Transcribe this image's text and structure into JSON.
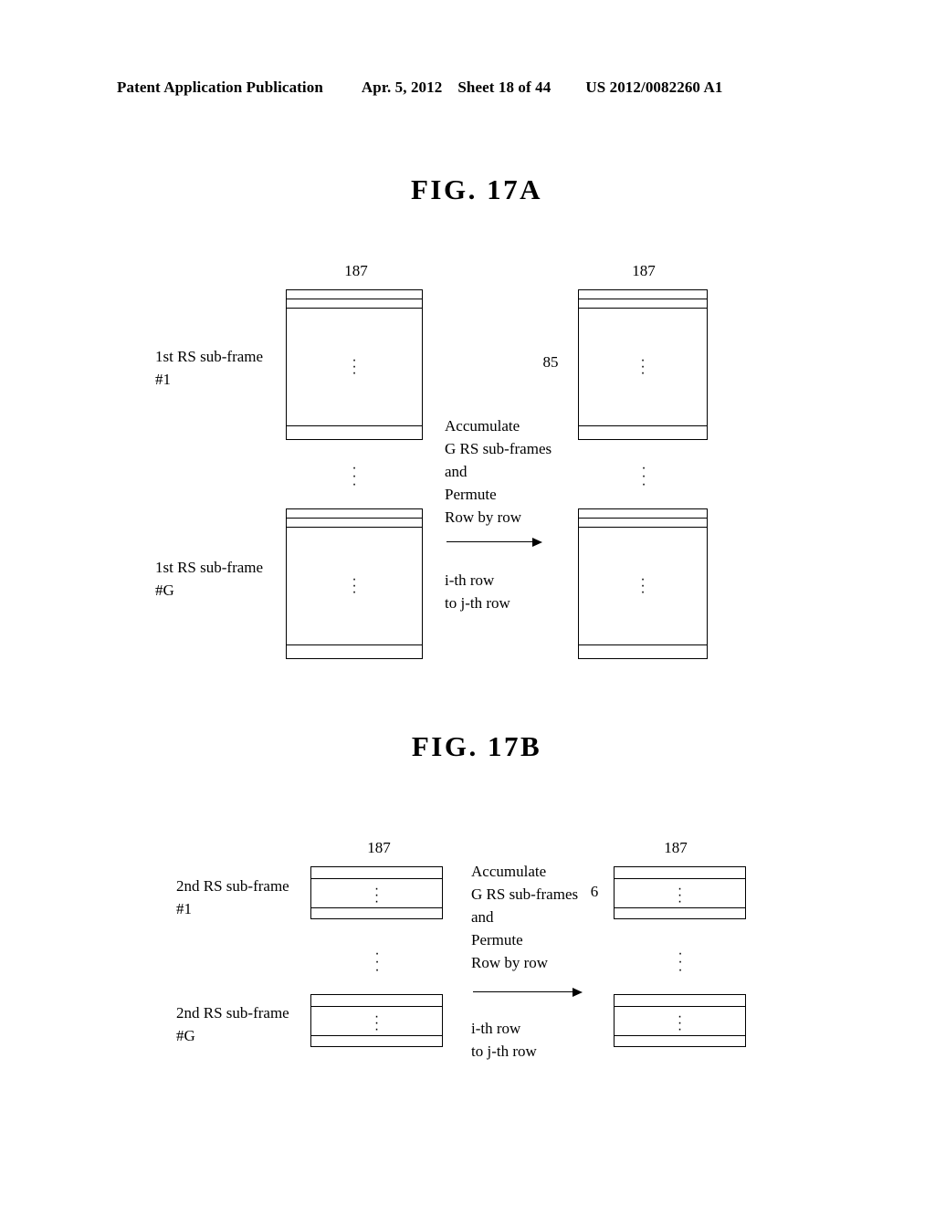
{
  "header": {
    "publication": "Patent Application Publication",
    "date": "Apr. 5, 2012",
    "sheet": "Sheet 18 of 44",
    "patent_number": "US 2012/0082260 A1"
  },
  "figures": [
    {
      "id": "fig17a",
      "title": "FIG. 17A",
      "left_blocks": [
        {
          "label_line1": "1st RS sub-frame",
          "label_line2": "#1",
          "top_width": "187",
          "dots": "⋮"
        },
        {
          "label_line1": "1st RS sub-frame",
          "label_line2": "#G",
          "top_width": "",
          "dots": "⋮"
        }
      ],
      "right_blocks": [
        {
          "top_width": "187",
          "side_label": "85",
          "dots": "⋮"
        },
        {
          "top_width": "",
          "side_label": "",
          "dots": "⋮"
        }
      ],
      "center": {
        "instruction": "Accumulate\nG RS sub-frames\nand\nPermute\nRow by row",
        "arrow": "arrow-right",
        "row_mapping": "i-th row\nto j-th row"
      },
      "column_ellipsis": "⋮"
    },
    {
      "id": "fig17b",
      "title": "FIG. 17B",
      "left_blocks": [
        {
          "label_line1": "2nd RS sub-frame",
          "label_line2": "#1",
          "top_width": "187",
          "dots": "⋮"
        },
        {
          "label_line1": "2nd RS sub-frame",
          "label_line2": "#G",
          "top_width": "",
          "dots": "⋮"
        }
      ],
      "right_blocks": [
        {
          "top_width": "187",
          "side_label": "6",
          "dots": "⋮"
        },
        {
          "top_width": "",
          "side_label": "",
          "dots": "⋮"
        }
      ],
      "center": {
        "instruction": "Accumulate\nG RS sub-frames\nand\nPermute\nRow by row",
        "arrow": "arrow-right",
        "row_mapping": "i-th row\nto j-th row"
      },
      "column_ellipsis": "⋮"
    }
  ]
}
